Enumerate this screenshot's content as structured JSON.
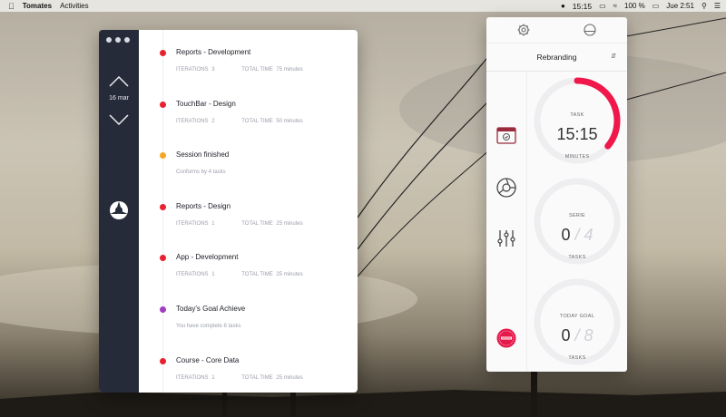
{
  "menubar": {
    "app_name": "Tomates",
    "activities": "Activities",
    "timer": "15:15",
    "battery": "100 %",
    "datetime": "Jue 2:51"
  },
  "timeline": {
    "date": "16 mar",
    "entries": [
      {
        "title": "Reports - Development",
        "iter_label": "ITERATIONS",
        "iter": "3",
        "time_label": "TOTAL TIME",
        "time": "75 minutes",
        "color": "#e8202f"
      },
      {
        "title": "TouchBar - Design",
        "iter_label": "ITERATIONS",
        "iter": "2",
        "time_label": "TOTAL TIME",
        "time": "50 minutes",
        "color": "#e8202f"
      },
      {
        "title": "Session finished",
        "note": "Conforms by 4 tasks",
        "color": "#f5a623"
      },
      {
        "title": "Reports - Design",
        "iter_label": "ITERATIONS",
        "iter": "1",
        "time_label": "TOTAL TIME",
        "time": "25 minutes",
        "color": "#e8202f"
      },
      {
        "title": "App - Development",
        "iter_label": "ITERATIONS",
        "iter": "1",
        "time_label": "TOTAL TIME",
        "time": "25 minutes",
        "color": "#e8202f"
      },
      {
        "title": "Today's Goal Achieve",
        "note": "You have complete 6 tasks",
        "color": "#a23cc0"
      },
      {
        "title": "Course - Core Data",
        "iter_label": "ITERATIONS",
        "iter": "1",
        "time_label": "TOTAL TIME",
        "time": "25 minutes",
        "color": "#e8202f"
      }
    ]
  },
  "popover": {
    "project": "Rebranding",
    "task": {
      "label": "TASK",
      "time": "15:15",
      "unit": "MINUTES",
      "progress": 0.36
    },
    "serie": {
      "label": "SERIE",
      "value": "0",
      "total": "4",
      "unit": "TASKS"
    },
    "goal": {
      "label": "TODAY GOAL",
      "value": "0",
      "total": "8",
      "unit": "TASKS"
    },
    "accent": "#f0174a"
  }
}
